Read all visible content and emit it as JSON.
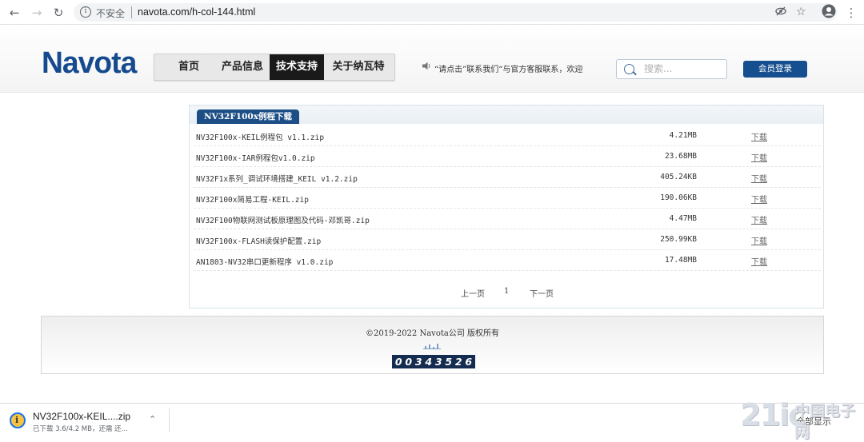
{
  "browser": {
    "insecure_label": "不安全",
    "url": "navota.com/h-col-144.html"
  },
  "header": {
    "logo": "Navota",
    "nav": [
      {
        "label": "首页",
        "active": false
      },
      {
        "label": "产品信息",
        "active": false
      },
      {
        "label": "技术支持",
        "active": true
      },
      {
        "label": "关于纳瓦特",
        "active": false
      }
    ],
    "notice": "“请点击”联系我们“与官方客服联系，欢迎",
    "search_placeholder": "搜索...",
    "login_label": "会员登录"
  },
  "downloads": {
    "title": "NV32F100x例程下载",
    "files": [
      {
        "name": "NV32F100x-KEIL例程包 v1.1.zip",
        "size": "4.21MB",
        "action": "下载"
      },
      {
        "name": "NV32F100x-IAR例程包v1.0.zip",
        "size": "23.68MB",
        "action": "下载"
      },
      {
        "name": "NV32F1x系列_调试环境搭建_KEIL v1.2.zip",
        "size": "405.24KB",
        "action": "下载"
      },
      {
        "name": "NV32F100x简易工程-KEIL.zip",
        "size": "190.06KB",
        "action": "下载"
      },
      {
        "name": "NV32F100物联网测试板原理图及代码-邓凯哥.zip",
        "size": "4.47MB",
        "action": "下载"
      },
      {
        "name": "NV32F100x-FLASH读保护配置.zip",
        "size": "250.99KB",
        "action": "下载"
      },
      {
        "name": "AN1803-NV32串口更新程序 v1.0.zip",
        "size": "17.48MB",
        "action": "下载"
      }
    ],
    "pager": {
      "prev": "上一页",
      "current": "1",
      "next": "下一页"
    }
  },
  "footer": {
    "copyright": "©2019-2022 Navota公司 版权所有",
    "counter": "00343526"
  },
  "download_shelf": {
    "filename": "NV32F100x-KEIL....zip",
    "status": "已下载 3.6/4.2 MB，还需 还...",
    "show_all": "全部显示"
  },
  "watermark": {
    "text1": "21ic",
    "text2": "中国电子网"
  },
  "colors": {
    "brand": "#164a8e",
    "tab": "#1d4f86",
    "login": "#164f8f",
    "counter_bg": "#142c4f"
  }
}
